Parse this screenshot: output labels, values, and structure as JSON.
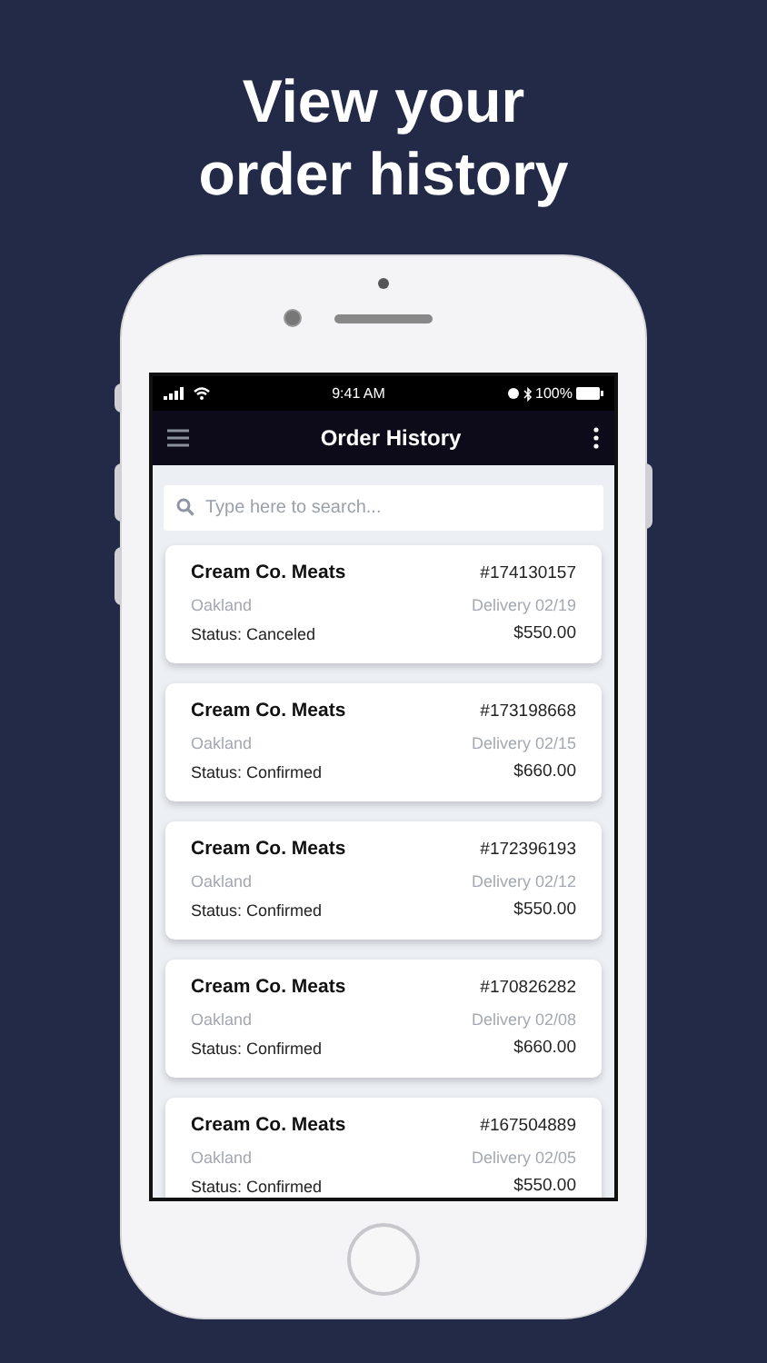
{
  "headline_lines": [
    "View your",
    "order history"
  ],
  "status_bar": {
    "time": "9:41 AM",
    "battery": "100%"
  },
  "nav_bar": {
    "title": "Order History"
  },
  "search": {
    "placeholder": "Type here to search..."
  },
  "orders": [
    {
      "vendor": "Cream Co. Meats",
      "number": "#174130157",
      "city": "Oakland",
      "delivery": "Delivery 02/19",
      "status": "Status: Canceled",
      "total": "$550.00"
    },
    {
      "vendor": "Cream Co. Meats",
      "number": "#173198668",
      "city": "Oakland",
      "delivery": "Delivery 02/15",
      "status": "Status: Confirmed",
      "total": "$660.00"
    },
    {
      "vendor": "Cream Co. Meats",
      "number": "#172396193",
      "city": "Oakland",
      "delivery": "Delivery 02/12",
      "status": "Status: Confirmed",
      "total": "$550.00"
    },
    {
      "vendor": "Cream Co. Meats",
      "number": "#170826282",
      "city": "Oakland",
      "delivery": "Delivery 02/08",
      "status": "Status: Confirmed",
      "total": "$660.00"
    },
    {
      "vendor": "Cream Co. Meats",
      "number": "#167504889",
      "city": "Oakland",
      "delivery": "Delivery 02/05",
      "status": "Status: Confirmed",
      "total": "$550.00"
    }
  ]
}
